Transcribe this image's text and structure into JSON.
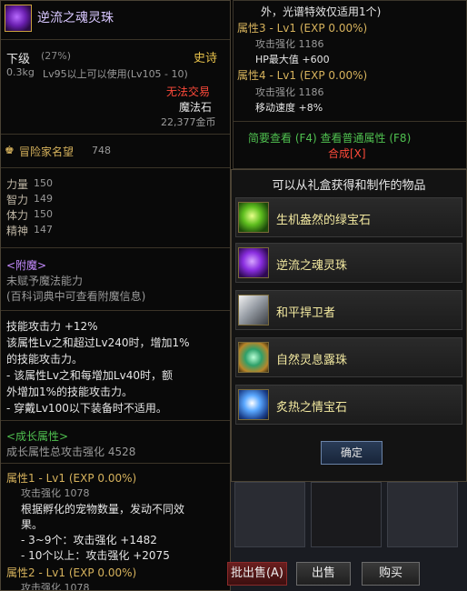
{
  "item": {
    "name": "逆流之魂灵珠",
    "grade": "下级",
    "grade_pct": "(27%)",
    "rarity": "史诗",
    "weight": "0.3kg",
    "level_req": "Lv95以上可以使用(Lv105 - 10)",
    "trade": "无法交易",
    "type": "魔法石",
    "price": "22,377金币",
    "fame_label": "冒险家名望",
    "fame_value": "748",
    "stats": [
      {
        "label": "力量",
        "value": "150"
      },
      {
        "label": "智力",
        "value": "149"
      },
      {
        "label": "体力",
        "value": "150"
      },
      {
        "label": "精神",
        "value": "147"
      }
    ],
    "enchant_title": "<附魔>",
    "enchant_none": "未赋予魔法能力",
    "enchant_hint": "(百科词典中可查看附魔信息)",
    "skill_line1": "技能攻击力 +12%",
    "skill_line2": "该属性Lv之和超过Lv240时，增加1%",
    "skill_line3": "的技能攻击力。",
    "skill_line4": "- 该属性Lv之和每增加Lv40时，额",
    "skill_line5": "外增加1%的技能攻击力。",
    "skill_line6": "- 穿戴Lv100以下装备时不适用。",
    "growth_title": "<成长属性>",
    "growth_total": "成长属性总攻击强化 4528",
    "attr1_title": "属性1 - Lv1 (EXP 0.00%)",
    "attr1_atk": "攻击强化 1078",
    "attr1_desc1": "根据孵化的宠物数量，发动不同效",
    "attr1_desc2": "果。",
    "attr1_b1": "- 3~9个：攻击强化 +1482",
    "attr1_b2": "- 10个以上：攻击强化 +2075",
    "attr2_title": "属性2 - Lv1 (EXP 0.00%)",
    "attr2_atk": "攻击强化 1078"
  },
  "right_top": {
    "line0": "外，光谱特效仅适用1个)",
    "attr3_title": "属性3 - Lv1 (EXP 0.00%)",
    "attr3_atk": "攻击强化 1186",
    "attr3_hp": "HP最大值 +600",
    "attr4_title": "属性4 - Lv1 (EXP 0.00%)",
    "attr4_atk": "攻击强化 1186",
    "attr4_move": "移动速度 +8%",
    "links": "简要查看 (F4) 查看普通属性 (F8)",
    "synth": "合成[X]"
  },
  "dialog": {
    "title": "可以从礼盒获得和制作的物品",
    "items": [
      {
        "label": "生机盎然的绿宝石",
        "icon": "green-gem-icon"
      },
      {
        "label": "逆流之魂灵珠",
        "icon": "purple-orb-icon"
      },
      {
        "label": "和平捍卫者",
        "icon": "shield-icon"
      },
      {
        "label": "自然灵息露珠",
        "icon": "dew-icon"
      },
      {
        "label": "炙热之情宝石",
        "icon": "blue-gem-icon"
      }
    ],
    "confirm": "确定"
  },
  "bottom": {
    "sell_partial": "批出售(A)",
    "sell": "出售",
    "buy": "购买"
  },
  "colors": {
    "rarity_gold": "#e6c04a",
    "trade_red": "#ff4a3a",
    "link_green": "#4fc04f",
    "enchant_purple": "#c48bff"
  }
}
